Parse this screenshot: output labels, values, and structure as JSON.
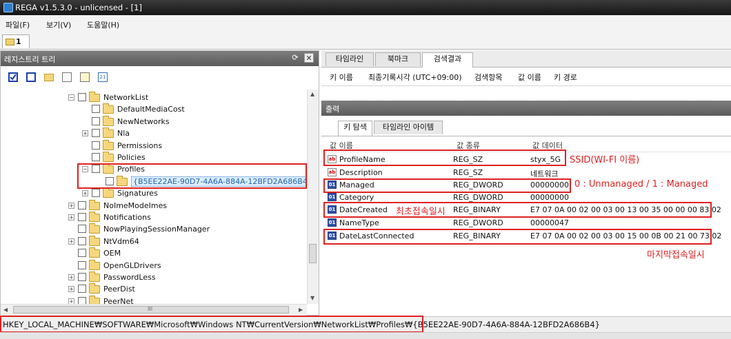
{
  "window": {
    "title": "REGA v1.5.3.0 - unlicensed - [1]"
  },
  "menu": [
    "파일(F)",
    "보기(V)",
    "도움말(H)"
  ],
  "doc_tab": {
    "label": "1"
  },
  "left_panel": {
    "title": "레지스트리 트리",
    "pin_glyph": "⟳",
    "close_glyph": "✕",
    "toolbar_icons": [
      "check-all-icon",
      "uncheck-all-icon",
      "open-folder-icon",
      "copy-icon",
      "notepad-icon",
      "calendar-icon"
    ],
    "calendar_text": "21",
    "tree": [
      {
        "label": "NetworkList",
        "expander": "−"
      },
      {
        "label": "DefaultMediaCost",
        "expander": ""
      },
      {
        "label": "NewNetworks",
        "expander": ""
      },
      {
        "label": "Nla",
        "expander": "+"
      },
      {
        "label": "Permissions",
        "expander": ""
      },
      {
        "label": "Policies",
        "expander": ""
      },
      {
        "label": "Profiles",
        "expander": "−"
      },
      {
        "label": "{B5EE22AE-90D7-4A6A-884A-12BFD2A686B4}",
        "expander": ""
      },
      {
        "label": "Signatures",
        "expander": "+"
      },
      {
        "label": "NoImeModeImes",
        "expander": "+"
      },
      {
        "label": "Notifications",
        "expander": "+"
      },
      {
        "label": "NowPlayingSessionManager",
        "expander": ""
      },
      {
        "label": "NtVdm64",
        "expander": "+"
      },
      {
        "label": "OEM",
        "expander": ""
      },
      {
        "label": "OpenGLDrivers",
        "expander": ""
      },
      {
        "label": "PasswordLess",
        "expander": "+"
      },
      {
        "label": "PeerDist",
        "expander": "+"
      },
      {
        "label": "PeerNet",
        "expander": "+"
      }
    ],
    "hscroll_label": "III"
  },
  "right_panel": {
    "tabs": [
      "타임라인",
      "북마크",
      "검색결과"
    ],
    "selected_tab": "검색결과",
    "columns": [
      "키 이름",
      "최종기록시각 (UTC+09:00)",
      "검색항목",
      "값 이름",
      "키 경로"
    ],
    "output": {
      "title": "출력",
      "tabs": [
        "키 탐색",
        "타임라인 아이템"
      ],
      "columns": [
        "값 이름",
        "값 종류",
        "값 데이터"
      ],
      "rows": [
        {
          "name": "ProfileName",
          "type": "REG_SZ",
          "data": "styx_5G",
          "icon": "ab"
        },
        {
          "name": "Description",
          "type": "REG_SZ",
          "data": "네트워크",
          "icon": "ab"
        },
        {
          "name": "Managed",
          "type": "REG_DWORD",
          "data": "00000000",
          "icon": "bin"
        },
        {
          "name": "Category",
          "type": "REG_DWORD",
          "data": "00000000",
          "icon": "bin"
        },
        {
          "name": "DateCreated",
          "type": "REG_BINARY",
          "data": "E7 07 0A 00 02 00 03 00 13 00 35 00 00 00 83 02",
          "icon": "bin"
        },
        {
          "name": "NameType",
          "type": "REG_DWORD",
          "data": "00000047",
          "icon": "bin"
        },
        {
          "name": "DateLastConnected",
          "type": "REG_BINARY",
          "data": "E7 07 0A 00 02 00 03 00 15 00 0B 00 21 00 73 02",
          "icon": "bin"
        }
      ]
    }
  },
  "annotations": {
    "ssid": "SSID(WI-FI 이름)",
    "managed": "0 : Unmanaged / 1 : Managed",
    "created": "최초접속일시",
    "last": "마지막접속일시"
  },
  "path": "HKEY_LOCAL_MACHINE₩SOFTWARE₩Microsoft₩Windows NT₩CurrentVersion₩NetworkList₩Profiles₩{B5EE22AE-90D7-4A6A-884A-12BFD2A686B4}",
  "colors": {
    "annotation": "#e02020",
    "selected_node": "#dceefc"
  }
}
